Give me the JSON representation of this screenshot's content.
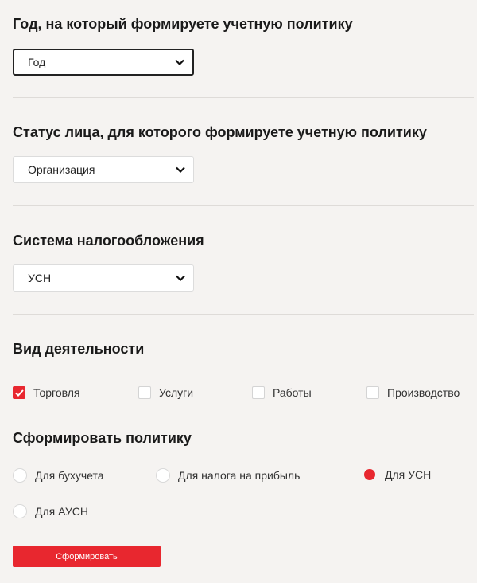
{
  "year": {
    "title": "Год, на который формируете учетную политику",
    "select_value": "Год"
  },
  "status": {
    "title": "Статус лица, для которого формируете учетную политику",
    "select_value": "Организация"
  },
  "tax_system": {
    "title": "Система налогообложения",
    "select_value": "УСН"
  },
  "activity": {
    "title": "Вид деятельности",
    "options": [
      {
        "label": "Торговля",
        "checked": true
      },
      {
        "label": "Услуги",
        "checked": false
      },
      {
        "label": "Работы",
        "checked": false
      },
      {
        "label": "Производство",
        "checked": false
      }
    ]
  },
  "policy": {
    "title": "Сформировать политику",
    "options": [
      {
        "label": "Для бухучета",
        "selected": false
      },
      {
        "label": "Для налога на прибыль",
        "selected": false
      },
      {
        "label": "Для УСН",
        "selected": true
      },
      {
        "label": "Для АУСН",
        "selected": false
      }
    ]
  },
  "submit_label": "Сформировать",
  "colors": {
    "accent": "#e8272f",
    "background": "#f5f3f1"
  },
  "icons": {
    "select_arrow": "chevron-down-icon",
    "checkbox_mark": "checkmark-icon"
  }
}
